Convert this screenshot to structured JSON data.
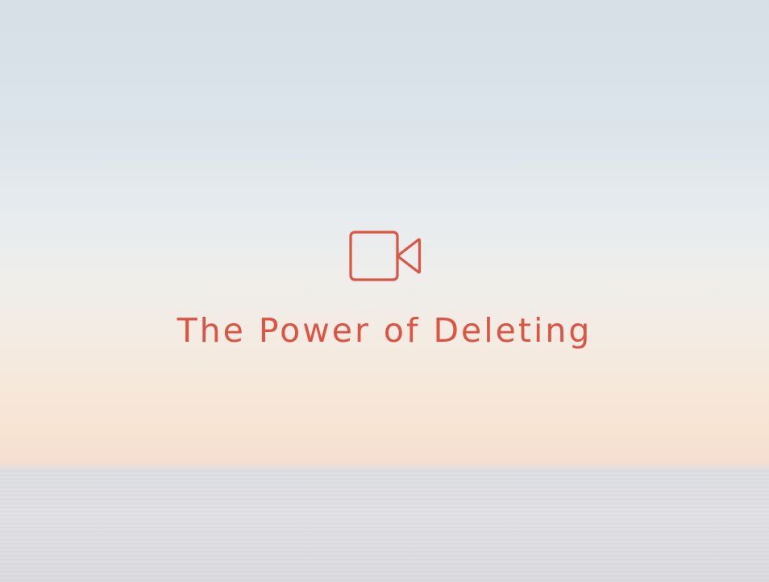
{
  "hero": {
    "title": "The Power of Deleting",
    "icon": "video-camera-icon",
    "accent_color": "#dc5443"
  }
}
